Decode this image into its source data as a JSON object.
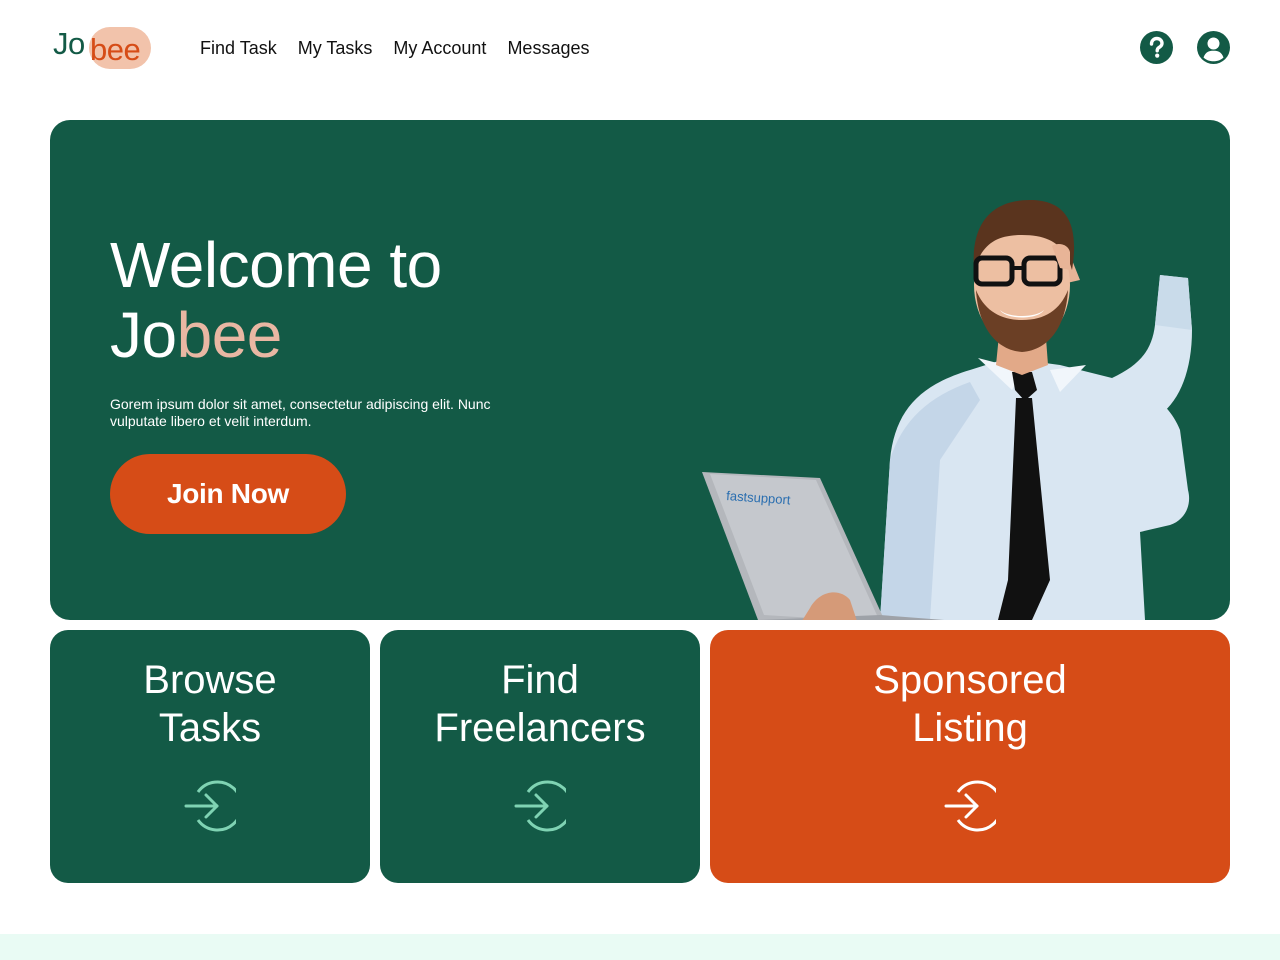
{
  "logo": {
    "part1": "Jo",
    "part2": "bee"
  },
  "nav": [
    "Find Task",
    "My Tasks",
    "My Account",
    "Messages"
  ],
  "header_icons": [
    "help-icon",
    "user-account-icon"
  ],
  "hero": {
    "title_line1": "Welcome to",
    "title_part1": "Jo",
    "title_part2": "bee",
    "subtitle": "Gorem ipsum dolor sit amet, consectetur adipiscing elit. Nunc vulputate libero et velit interdum.",
    "cta_label": "Join Now",
    "laptop_text": "fastsupport"
  },
  "cards": [
    {
      "line1": "Browse",
      "line2": "Tasks",
      "icon": "arrow-login-icon"
    },
    {
      "line1": "Find",
      "line2": "Freelancers",
      "icon": "arrow-login-icon"
    },
    {
      "line1": "Sponsored",
      "line2": "Listing",
      "icon": "arrow-login-icon"
    }
  ],
  "colors": {
    "primary_green": "#135a46",
    "accent_orange": "#d64c17",
    "accent_peach": "#e9b7a3",
    "icon_mint": "#7fd3b3",
    "footer_mint": "#e9fbf4"
  }
}
